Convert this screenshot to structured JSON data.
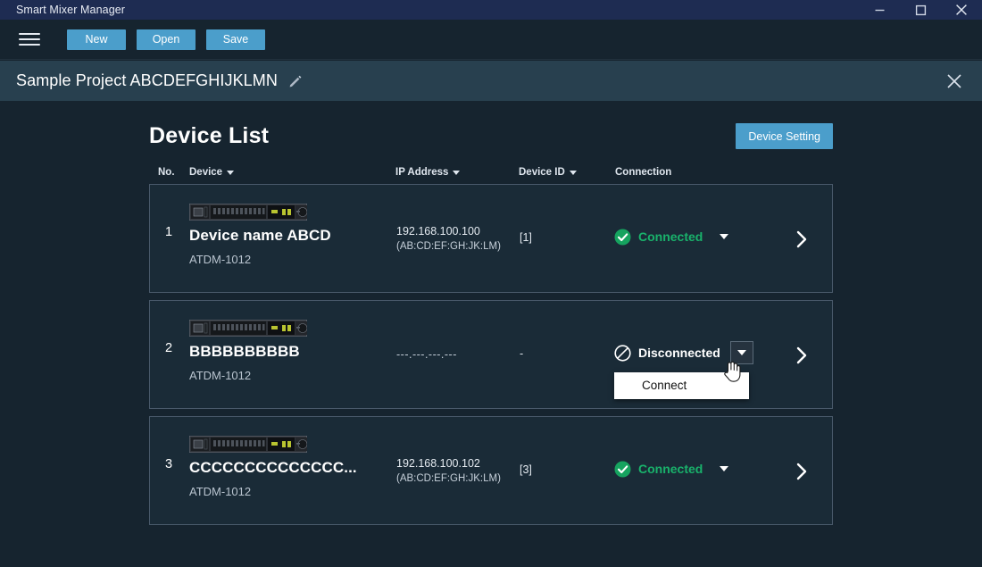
{
  "window": {
    "title": "Smart Mixer Manager",
    "controls": [
      {
        "name": "minimize-button",
        "glyph": "minimize-icon"
      },
      {
        "name": "maximize-button",
        "glyph": "maximize-icon"
      },
      {
        "name": "close-button",
        "glyph": "close-icon"
      }
    ]
  },
  "toolbar": {
    "menu_icon": "hamburger-menu-icon",
    "new_label": "New",
    "open_label": "Open",
    "save_label": "Save"
  },
  "project": {
    "title": "Sample Project ABCDEFGHIJKLMN",
    "edit_icon": "pencil-icon",
    "close_icon": "close-icon"
  },
  "main": {
    "page_title": "Device List",
    "device_setting_label": "Device Setting",
    "columns": {
      "no": "No.",
      "device": "Device",
      "ip_address": "IP Address",
      "device_id": "Device ID",
      "connection": "Connection"
    },
    "rows": [
      {
        "no": "1",
        "name": "Device name ABCD",
        "model": "ATDM-1012",
        "ip": "192.168.100.100",
        "mac": "(AB:CD:EF:GH:JK:LM)",
        "device_id": "[1]",
        "status": "Connected",
        "status_state": "connected",
        "status_icon": "check-circle-icon",
        "chevron_icon": "chevron-right-icon"
      },
      {
        "no": "2",
        "name": "BBBBBBBBBB",
        "model": "ATDM-1012",
        "ip": "---.---.---.---",
        "mac": "",
        "device_id": "-",
        "status": "Disconnected",
        "status_state": "disconnected",
        "status_icon": "block-circle-icon",
        "chevron_icon": "chevron-right-icon"
      },
      {
        "no": "3",
        "name": "CCCCCCCCCCCCCC...",
        "model": "ATDM-1012",
        "ip": "192.168.100.102",
        "mac": "(AB:CD:EF:GH:JK:LM)",
        "device_id": "[3]",
        "status": "Connected",
        "status_state": "connected",
        "status_icon": "check-circle-icon",
        "chevron_icon": "chevron-right-icon"
      }
    ],
    "connection_dropdown": {
      "open_for_row": 2,
      "items": [
        "Connect"
      ],
      "connect_label": "Connect"
    }
  },
  "colors": {
    "titlebar_bg": "#1e2c52",
    "app_bg": "#16242f",
    "projectbar_bg": "#28404f",
    "card_bg": "#1a2b37",
    "card_border": "#49596a",
    "accent_blue": "#4b9ecb",
    "connected_green": "#19b26b",
    "menu_bg": "#ffffff"
  }
}
